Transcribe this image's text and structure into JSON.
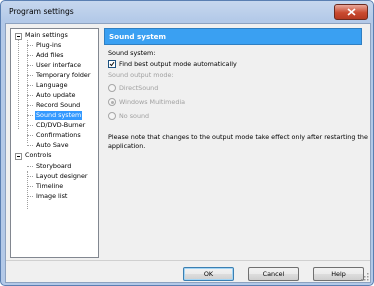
{
  "window": {
    "title": "Program settings"
  },
  "tree": {
    "groups": [
      {
        "label": "Main settings",
        "expanded": true,
        "items": [
          "Plug-ins",
          "Add files",
          "User interface",
          "Temporary folder",
          "Language",
          "Auto update",
          "Record Sound",
          "Sound system",
          "CD/DVD-Burner",
          "Confirmations",
          "Auto Save"
        ]
      },
      {
        "label": "Controls",
        "expanded": true,
        "items": [
          "Storyboard",
          "Layout designer",
          "Timeline",
          "Image list"
        ]
      }
    ],
    "selected": "Sound system"
  },
  "page": {
    "header": "Sound system",
    "section_label": "Sound system:",
    "auto_checkbox": {
      "label": "Find best output mode automatically",
      "checked": true
    },
    "output_mode_label": "Sound output mode:",
    "radio_options": [
      {
        "label": "DirectSound",
        "selected": false
      },
      {
        "label": "Windows Multimedia",
        "selected": true
      },
      {
        "label": "No sound",
        "selected": false
      }
    ],
    "note_line1": "Please note that changes to the output mode take effect only after restarting the",
    "note_line2": "application."
  },
  "buttons": {
    "ok": "OK",
    "cancel": "Cancel",
    "help": "Help"
  },
  "colors": {
    "header_bg": "#3aa0f2",
    "selection": "#3399ff",
    "close_button": "#c94a30"
  }
}
